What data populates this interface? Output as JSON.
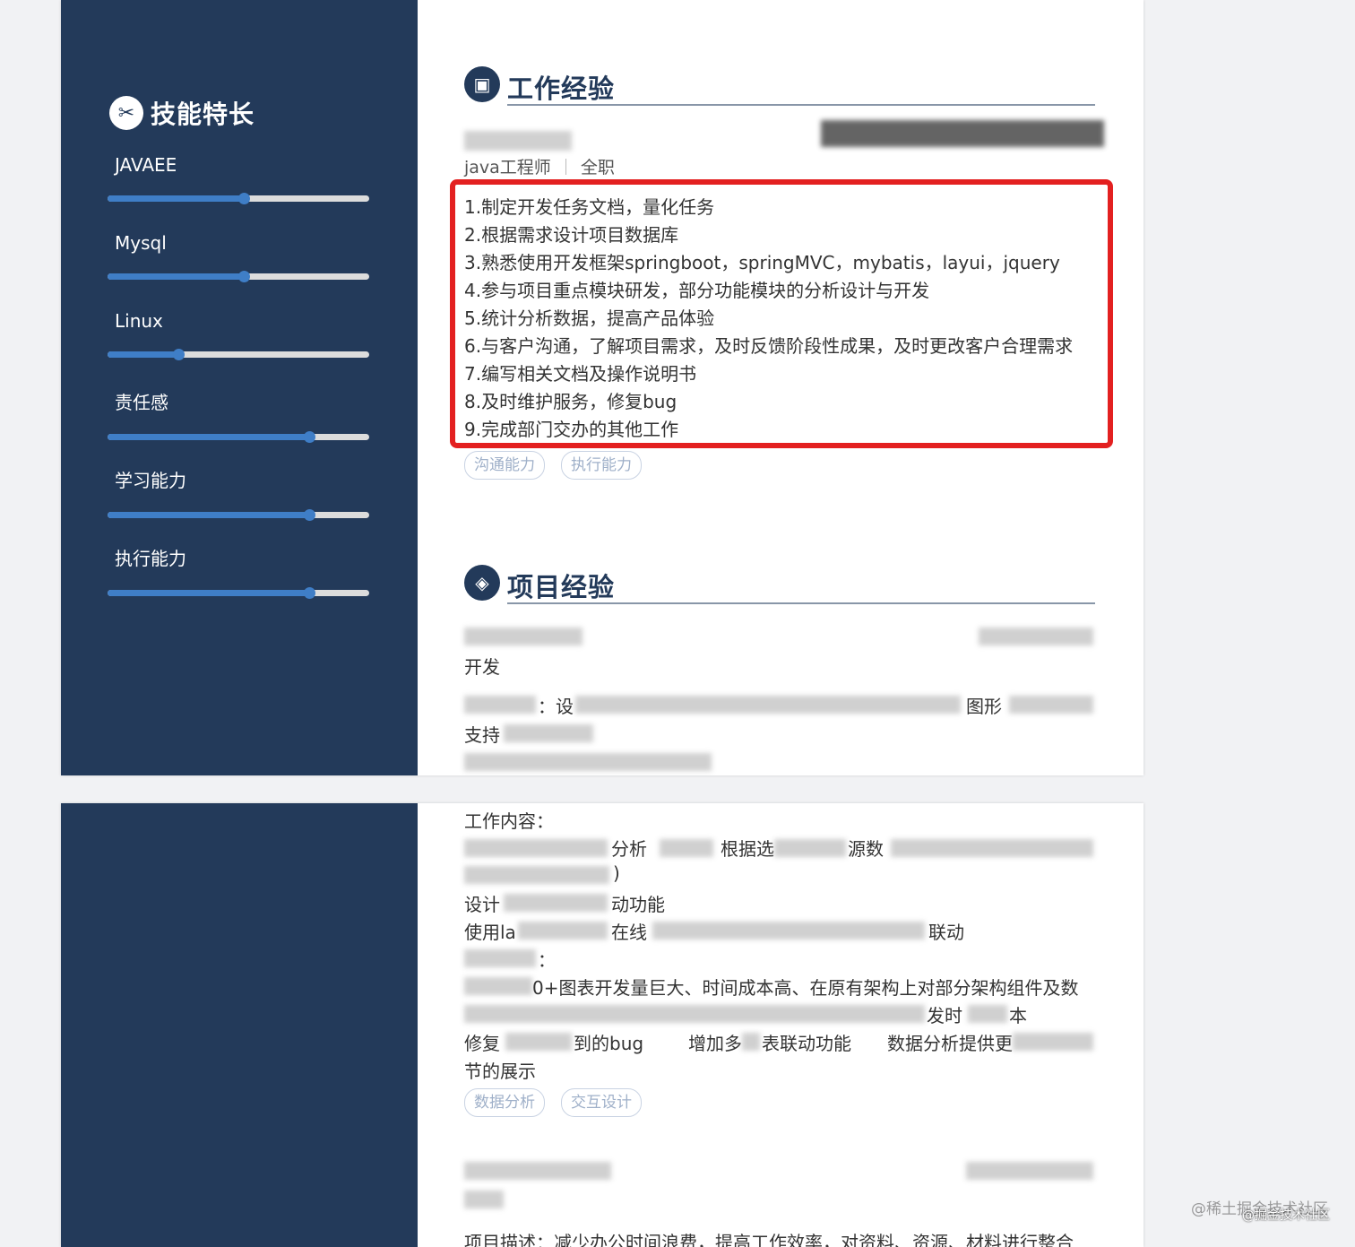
{
  "sidebar": {
    "skills_title": "技能特长",
    "skills": [
      {
        "name": "JAVAEE",
        "level": 0.52
      },
      {
        "name": "Mysql",
        "level": 0.52
      },
      {
        "name": "Linux",
        "level": 0.27
      },
      {
        "name": "责任感",
        "level": 0.77
      },
      {
        "name": "学习能力",
        "level": 0.77
      },
      {
        "name": "执行能力",
        "level": 0.77
      }
    ]
  },
  "work": {
    "title": "工作经验",
    "position": "java工程师",
    "type": "全职",
    "duties": [
      "1.制定开发任务文档，量化任务",
      "2.根据需求设计项目数据库",
      "3.熟悉使用开发框架springboot，springMVC，mybatis，layui，jquery",
      "4.参与项目重点模块研发，部分功能模块的分析设计与开发",
      "5.统计分析数据，提高产品体验",
      "6.与客户沟通，了解项目需求，及时反馈阶段性成果，及时更改客户合理需求",
      "7.编写相关文档及操作说明书",
      "8.及时维护服务，修复bug",
      "9.完成部门交办的其他工作"
    ],
    "tags": [
      "沟通能力",
      "执行能力"
    ]
  },
  "project": {
    "title": "项目经验",
    "role": "开发",
    "desc_fragment": "：设",
    "desc_fragment2": "图形",
    "support_fragment": "支持"
  },
  "page2": {
    "work_content_label": "工作内容：",
    "lines": [
      {
        "a": "分析",
        "b": "根据选",
        "c": "源数"
      },
      {
        "a": ")"
      },
      {
        "a": "设计",
        "b": "动功能"
      },
      {
        "a": "使用la",
        "b": "在线",
        "c": "联动"
      },
      {
        "a": "：",
        "b": "0+图表开发量巨大、时间成本高、在原有架构上对部分架构组件及数"
      },
      {
        "a": "发时",
        "b": "本"
      },
      {
        "a": "修复",
        "b": "到的bug",
        "c": "增加多",
        "d": "表联动功能",
        "e": "数据分析提供更"
      },
      {
        "a": "节的展示"
      }
    ],
    "tags": [
      "数据分析",
      "交互设计"
    ],
    "project_desc": "项目描述：减少办公时间浪费，提高工作效率，对资料、资源、材料进行整合"
  },
  "watermark": "@稀土掘金技术社区",
  "watermark2": "@掘金技术社区"
}
